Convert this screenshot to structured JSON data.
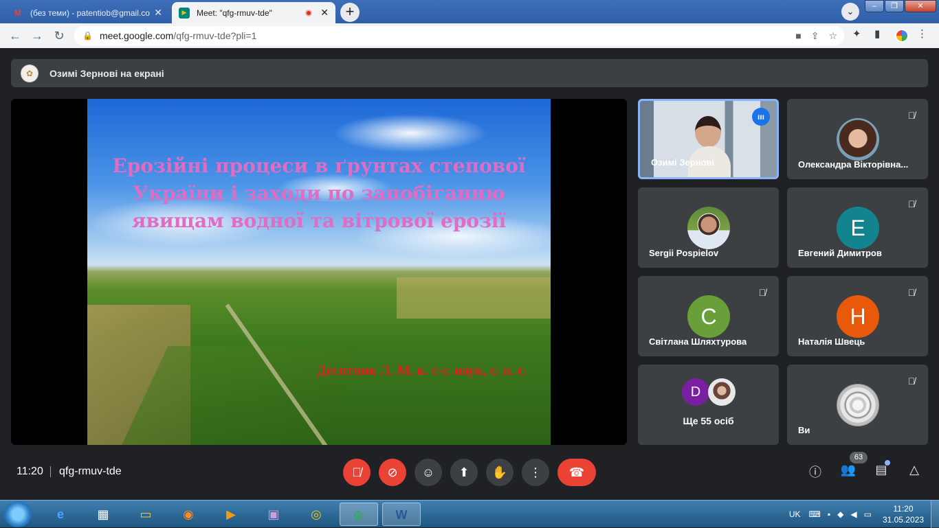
{
  "browser": {
    "tabs": [
      {
        "title": "(без теми) - patentiob@gmail.co",
        "favicon": "gmail-icon",
        "active": false
      },
      {
        "title": "Meet: \"qfg-rmuv-tde\"",
        "favicon": "meet-icon",
        "active": true,
        "recording": true
      }
    ],
    "url_domain": "meet.google.com",
    "url_path": "/qfg-rmuv-tde?pli=1"
  },
  "meet": {
    "presenting_banner": "Озимі Зернові на екрані",
    "slide": {
      "title_lines": [
        "Ерозійні процеси в ґрунтах степової",
        "України і заходи по запобіганню",
        "явищам водної та вітрової ерозії"
      ],
      "author": "Десятник Л. М. к. с-г. наук, с. н. с."
    },
    "participants": [
      {
        "name": "Озимі Зернові",
        "type": "video",
        "speaking": true
      },
      {
        "name": "Олександра Вікторівна...",
        "type": "photo",
        "muted": true
      },
      {
        "name": "Sergii Pospielov",
        "type": "photo",
        "muted": false
      },
      {
        "name": "Евгений Димитров",
        "type": "letter",
        "letter": "Е",
        "color": "#12848f",
        "muted": true
      },
      {
        "name": "Світлана Шляхтурова",
        "type": "letter",
        "letter": "С",
        "color": "#689f38",
        "muted": true
      },
      {
        "name": "Наталія Швець",
        "type": "letter",
        "letter": "Н",
        "color": "#e8590c",
        "muted": true
      },
      {
        "name": "Ще 55 осіб",
        "type": "more",
        "letter": "D"
      },
      {
        "name": "Ви",
        "type": "photo",
        "muted": true
      }
    ],
    "time": "11:20",
    "meeting_code": "qfg-rmuv-tde",
    "participant_count": "63"
  },
  "taskbar": {
    "language": "UK",
    "time": "11:20",
    "date": "31.05.2023"
  }
}
